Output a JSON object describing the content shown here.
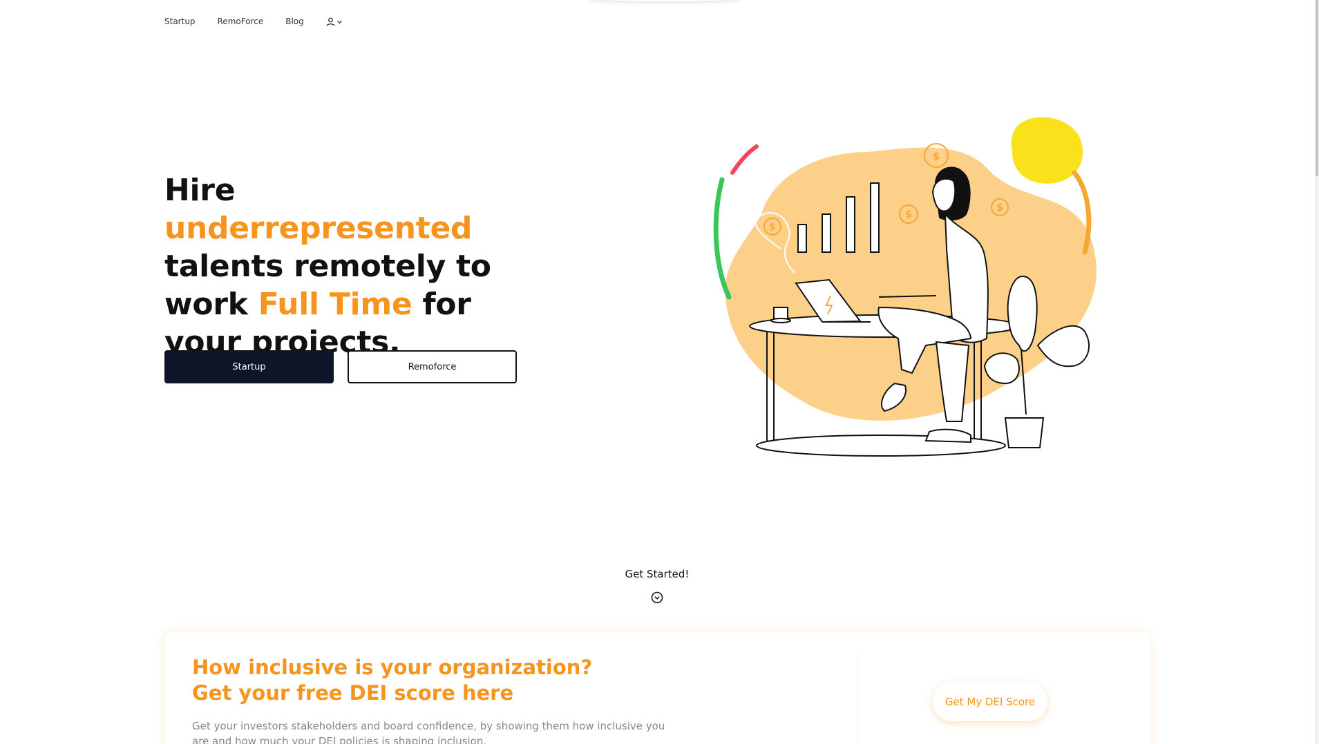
{
  "nav": {
    "items": [
      {
        "label": "Startup"
      },
      {
        "label": "RemoForce"
      },
      {
        "label": "Blog"
      }
    ]
  },
  "hero": {
    "title": {
      "p1": "Hire ",
      "h1": "underrepresented",
      "p2": " talents remotely to work ",
      "h2": "Full Time",
      "p3": " for your projects."
    },
    "primary_button": "Startup",
    "secondary_button": "Remoforce"
  },
  "get_started": {
    "label": "Get Started!"
  },
  "dei": {
    "title_line1": "How inclusive is your organization?",
    "title_line2": "Get your free DEI score here",
    "description": "Get your investors stakeholders and board confidence, by showing them how inclusive you are and how much your DEI policies is shaping inclusion.",
    "button": "Get My DEI Score"
  },
  "colors": {
    "accent": "#f7941d",
    "primary_button_bg": "#0e1528",
    "blob": "#fdd08a",
    "sun": "#f9e21b",
    "red_arc": "#f0455a",
    "green_arc": "#3ac65a",
    "orange_arc": "#f6a72f"
  }
}
